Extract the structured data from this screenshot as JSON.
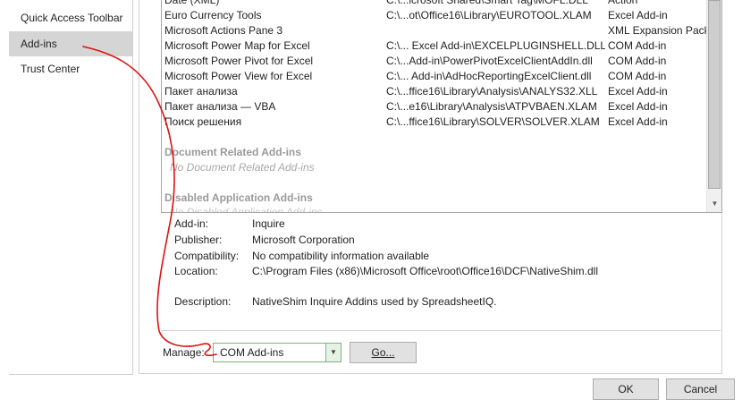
{
  "nav": {
    "items": [
      {
        "label": "Quick Access Toolbar",
        "selected": false
      },
      {
        "label": "Add-ins",
        "selected": true
      },
      {
        "label": "Trust Center",
        "selected": false
      }
    ]
  },
  "addins": {
    "rows": [
      {
        "name": "Date (XML)",
        "location": "C:\\...icrosoft Shared\\Smart Tag\\MOFL.DLL",
        "type": "Action"
      },
      {
        "name": "Euro Currency Tools",
        "location": "C:\\...ot\\Office16\\Library\\EUROTOOL.XLAM",
        "type": "Excel Add-in"
      },
      {
        "name": "Microsoft Actions Pane 3",
        "location": "",
        "type": "XML Expansion Pack"
      },
      {
        "name": "Microsoft Power Map for Excel",
        "location": "C:\\... Excel Add-in\\EXCELPLUGINSHELL.DLL",
        "type": "COM Add-in"
      },
      {
        "name": "Microsoft Power Pivot for Excel",
        "location": "C:\\...Add-in\\PowerPivotExcelClientAddIn.dll",
        "type": "COM Add-in"
      },
      {
        "name": "Microsoft Power View for Excel",
        "location": "C:\\... Add-in\\AdHocReportingExcelClient.dll",
        "type": "COM Add-in"
      },
      {
        "name": "Пакет анализа",
        "location": "C:\\...ffice16\\Library\\Analysis\\ANALYS32.XLL",
        "type": "Excel Add-in"
      },
      {
        "name": "Пакет анализа — VBA",
        "location": "C:\\...e16\\Library\\Analysis\\ATPVBAEN.XLAM",
        "type": "Excel Add-in"
      },
      {
        "name": "Поиск решения",
        "location": "C:\\...ffice16\\Library\\SOLVER\\SOLVER.XLAM",
        "type": "Excel Add-in"
      }
    ],
    "document_section": {
      "title": "Document Related Add-ins",
      "empty": "No Document Related Add-ins"
    },
    "disabled_section": {
      "title": "Disabled Application Add-ins",
      "empty": "No Disabled Application Add-ins"
    }
  },
  "details": {
    "addin_label": "Add-in:",
    "addin_value": "Inquire",
    "publisher_label": "Publisher:",
    "publisher_value": "Microsoft Corporation",
    "compat_label": "Compatibility:",
    "compat_value": "No compatibility information available",
    "location_label": "Location:",
    "location_value": "C:\\Program Files (x86)\\Microsoft Office\\root\\Office16\\DCF\\NativeShim.dll",
    "description_label": "Description:",
    "description_value": "NativeShim Inquire Addins used by SpreadsheetIQ."
  },
  "manage": {
    "label": "Manage:",
    "selected": "COM Add-ins",
    "go_label": "Go..."
  },
  "footer": {
    "ok_label": "OK",
    "cancel_label": "Cancel"
  },
  "colors": {
    "annotation": "#e01010",
    "selected_nav": "#d5d5d5"
  }
}
